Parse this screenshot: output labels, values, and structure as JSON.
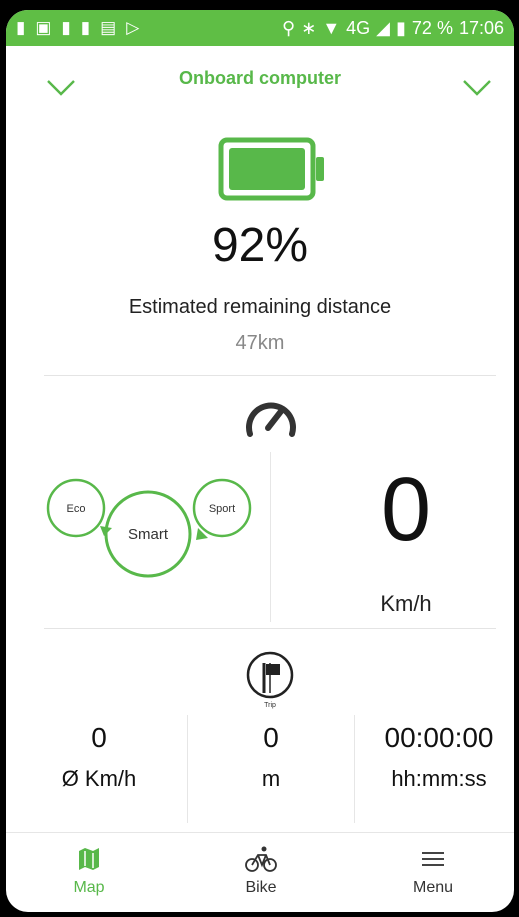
{
  "status_bar": {
    "network": "4G",
    "battery": "72 %",
    "time": "17:06"
  },
  "header": {
    "title": "Onboard computer"
  },
  "battery": {
    "percent": "92%",
    "level": 0.92,
    "estimated_label": "Estimated remaining distance",
    "estimated_value": "47km"
  },
  "modes": {
    "left": "Eco",
    "center": "Smart",
    "right": "Sport"
  },
  "speed": {
    "value": "0",
    "unit": "Km/h"
  },
  "trip": {
    "label": "Trip",
    "stats": [
      {
        "value": "0",
        "unit": "Ø Km/h"
      },
      {
        "value": "0",
        "unit": "m"
      },
      {
        "value": "00:00:00",
        "unit": "hh:mm:ss"
      }
    ]
  },
  "tabs": [
    {
      "label": "Map",
      "icon": "map-icon",
      "active": true
    },
    {
      "label": "Bike",
      "icon": "bike-icon",
      "active": false
    },
    {
      "label": "Menu",
      "icon": "menu-icon",
      "active": false
    }
  ],
  "colors": {
    "accent": "#58b84a",
    "status_bar": "#5fbe45"
  }
}
